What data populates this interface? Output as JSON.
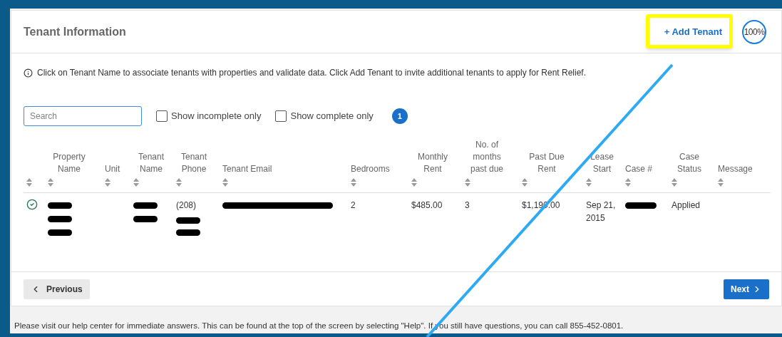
{
  "panel": {
    "title": "Tenant Information",
    "add_button": "+ Add Tenant",
    "progress": "100%"
  },
  "info": "Click on Tenant Name to associate tenants with properties and validate data. Click Add Tenant to invite additional tenants to apply for Rent Relief.",
  "filters": {
    "search_placeholder": "Search",
    "checkboxes": [
      {
        "label": "Show incomplete only",
        "checked": false
      },
      {
        "label": "Show complete only",
        "checked": false
      }
    ],
    "count": "1"
  },
  "table": {
    "columns": [
      "Property Name",
      "Unit",
      "Tenant Name",
      "Tenant Phone",
      "Tenant Email",
      "Bedrooms",
      "Monthly Rent",
      "No. of months past due",
      "Past Due Rent",
      "Lease Start",
      "Case #",
      "Case Status",
      "Message"
    ],
    "rows": [
      {
        "status": {
          "kind": "check"
        },
        "cells": [
          {
            "kind": "redacted"
          },
          {
            "kind": "empty"
          },
          {
            "kind": "redacted"
          },
          {
            "kind": "partly_redacted",
            "text": "(208)"
          },
          {
            "kind": "redacted"
          },
          {
            "kind": "text",
            "text": "2"
          },
          {
            "kind": "text",
            "text": "$485.00"
          },
          {
            "kind": "text",
            "text": "3"
          },
          {
            "kind": "text",
            "text": "$1,190.00"
          },
          {
            "kind": "text",
            "text": "Sep 21, 2015"
          },
          {
            "kind": "redacted"
          },
          {
            "kind": "text",
            "text": "Applied"
          },
          {
            "kind": "empty"
          }
        ]
      }
    ]
  },
  "nav": {
    "previous": "Previous",
    "next": "Next"
  },
  "footer": "Please visit our help center for immediate answers. This can be found at the top of the screen by selecting \"Help\". If you still have questions, you can call 855-452-0801."
}
